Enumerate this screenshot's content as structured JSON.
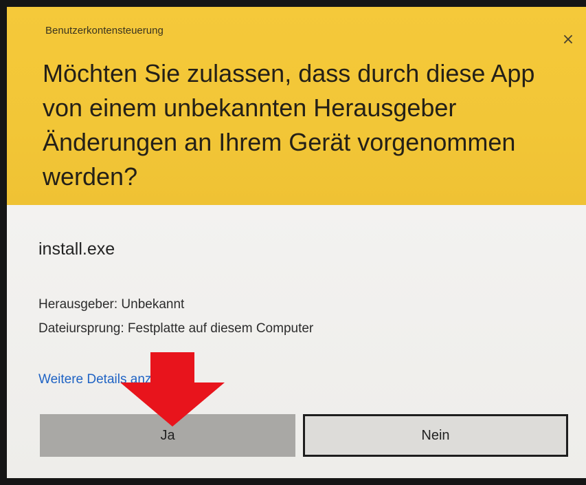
{
  "dialog": {
    "caption": "Benutzerkontensteuerung",
    "close_glyph": "×",
    "question": "Möchten Sie zulassen, dass durch diese App von einem unbekannten Herausgeber Änderungen an Ihrem Gerät vorgenommen werden?",
    "app_name": "install.exe",
    "publisher": "Herausgeber: Unbekannt",
    "origin": "Dateiursprung: Festplatte auf diesem Computer",
    "details_link": "Weitere Details anzeigen",
    "yes_label": "Ja",
    "no_label": "Nein"
  },
  "colors": {
    "header": "#f2c637",
    "body": "#eeedea",
    "link": "#1f63c4",
    "yes_button": "#a9a8a5",
    "no_button": "#dddcd9",
    "annotation_arrow": "#e8141c"
  },
  "icons": {
    "close": "close-icon",
    "annotation": "red-arrow-down-icon"
  }
}
